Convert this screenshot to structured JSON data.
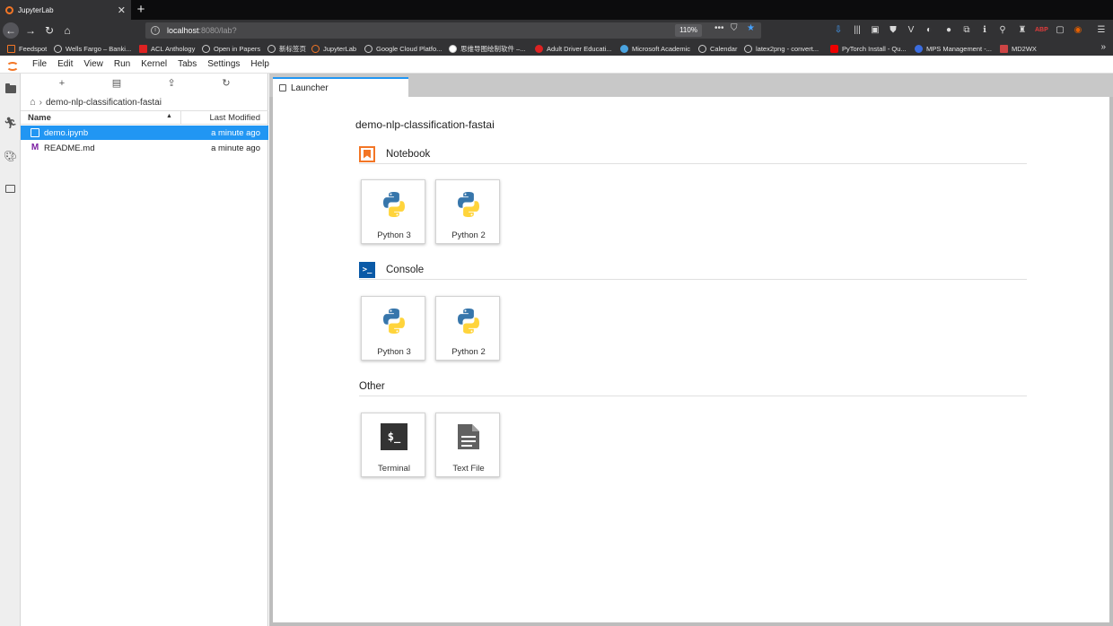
{
  "browser": {
    "tab_title": "JupyterLab",
    "url_host": "localhost",
    "url_path": ":8080/lab?",
    "zoom": "110%",
    "bookmarks": [
      "Feedspot",
      "Wells Fargo – Banki...",
      "ACL Anthology",
      "Open in Papers",
      "新标签页",
      "JupyterLab",
      "Google Cloud Platfo...",
      "思维导图绘制软件 –...",
      "Adult Driver Educati...",
      "Microsoft Academic",
      "Calendar",
      "latex2png - convert...",
      "PyTorch Install - Qu...",
      "MPS Management -...",
      "MD2WX"
    ]
  },
  "menu": {
    "items": [
      "File",
      "Edit",
      "View",
      "Run",
      "Kernel",
      "Tabs",
      "Settings",
      "Help"
    ]
  },
  "filebrowser": {
    "breadcrumb": "demo-nlp-classification-fastai",
    "col_name": "Name",
    "col_modified": "Last Modified",
    "files": [
      {
        "name": "demo.ipynb",
        "modified": "a minute ago"
      },
      {
        "name": "README.md",
        "modified": "a minute ago"
      }
    ]
  },
  "main": {
    "tab_label": "Launcher",
    "launcher_title": "demo-nlp-classification-fastai",
    "sections": {
      "notebook": {
        "title": "Notebook",
        "cards": [
          "Python 3",
          "Python 2"
        ]
      },
      "console": {
        "title": "Console",
        "cards": [
          "Python 3",
          "Python 2"
        ]
      },
      "other": {
        "title": "Other",
        "cards": [
          "Terminal",
          "Text File"
        ]
      }
    }
  },
  "colors": {
    "accent": "#2196f3",
    "jupyter_orange": "#f37626",
    "console_blue": "#0b5aa7"
  }
}
